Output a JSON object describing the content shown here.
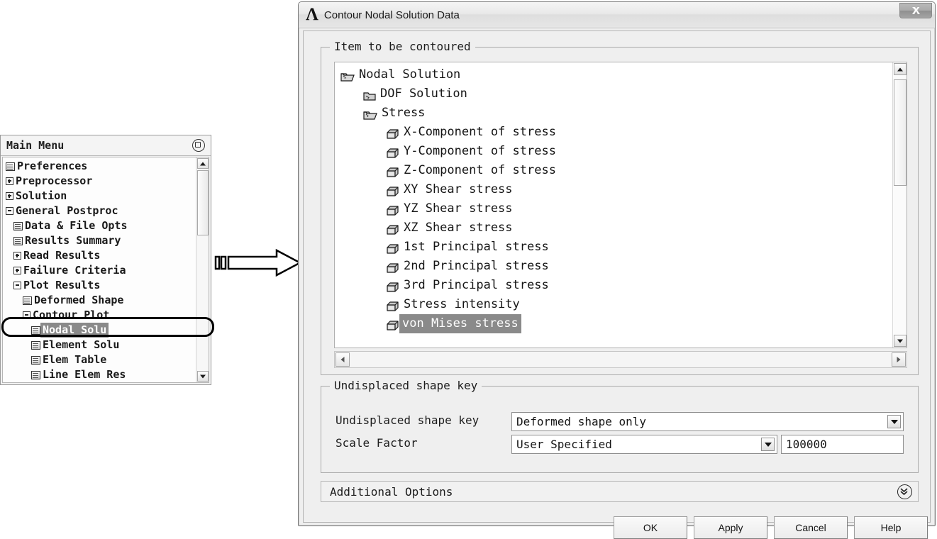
{
  "main_menu": {
    "title": "Main Menu",
    "pin_icon": "pin-circle-icon",
    "items": [
      {
        "label": "Preferences",
        "indent": 0,
        "icon": "document-icon",
        "selected": false
      },
      {
        "label": "Preprocessor",
        "indent": 0,
        "icon": "plus-box-icon",
        "selected": false
      },
      {
        "label": "Solution",
        "indent": 0,
        "icon": "plus-box-icon",
        "selected": false
      },
      {
        "label": "General Postproc",
        "indent": 0,
        "icon": "minus-box-icon",
        "selected": false
      },
      {
        "label": "Data & File Opts",
        "indent": 1,
        "icon": "document-icon",
        "selected": false
      },
      {
        "label": "Results Summary",
        "indent": 1,
        "icon": "document-icon",
        "selected": false
      },
      {
        "label": "Read Results",
        "indent": 1,
        "icon": "plus-box-icon",
        "selected": false
      },
      {
        "label": "Failure Criteria",
        "indent": 1,
        "icon": "plus-box-icon",
        "selected": false
      },
      {
        "label": "Plot Results",
        "indent": 1,
        "icon": "minus-box-icon",
        "selected": false
      },
      {
        "label": "Deformed Shape",
        "indent": 2,
        "icon": "document-icon",
        "selected": false
      },
      {
        "label": "Contour Plot",
        "indent": 2,
        "icon": "minus-box-icon",
        "selected": false
      },
      {
        "label": "Nodal Solu",
        "indent": 3,
        "icon": "document-icon",
        "selected": true
      },
      {
        "label": "Element Solu",
        "indent": 3,
        "icon": "document-icon",
        "selected": false
      },
      {
        "label": "Elem Table",
        "indent": 3,
        "icon": "document-icon",
        "selected": false
      },
      {
        "label": "Line Elem Res",
        "indent": 3,
        "icon": "document-icon",
        "selected": false
      }
    ]
  },
  "annotation": {
    "arrow_icon": "right-arrow-callout",
    "highlight_target": "Nodal Solu"
  },
  "dialog": {
    "title": "Contour Nodal Solution Data",
    "logo_glyph": "Λ",
    "close_label": "✕",
    "item_group": {
      "legend": "Item to be contoured",
      "tree": [
        {
          "label": "Nodal Solution",
          "indent": 0,
          "icon": "folder-open-icon",
          "selected": false
        },
        {
          "label": "DOF Solution",
          "indent": 1,
          "icon": "folder-closed-icon",
          "selected": false
        },
        {
          "label": "Stress",
          "indent": 1,
          "icon": "folder-open-icon",
          "selected": false
        },
        {
          "label": "X-Component of stress",
          "indent": 2,
          "icon": "cube-icon",
          "selected": false
        },
        {
          "label": "Y-Component of stress",
          "indent": 2,
          "icon": "cube-icon",
          "selected": false
        },
        {
          "label": "Z-Component of stress",
          "indent": 2,
          "icon": "cube-icon",
          "selected": false
        },
        {
          "label": "XY Shear stress",
          "indent": 2,
          "icon": "cube-icon",
          "selected": false
        },
        {
          "label": "YZ Shear stress",
          "indent": 2,
          "icon": "cube-icon",
          "selected": false
        },
        {
          "label": "XZ Shear stress",
          "indent": 2,
          "icon": "cube-icon",
          "selected": false
        },
        {
          "label": "1st Principal stress",
          "indent": 2,
          "icon": "cube-icon",
          "selected": false
        },
        {
          "label": "2nd Principal stress",
          "indent": 2,
          "icon": "cube-icon",
          "selected": false
        },
        {
          "label": "3rd Principal stress",
          "indent": 2,
          "icon": "cube-icon",
          "selected": false
        },
        {
          "label": "Stress intensity",
          "indent": 2,
          "icon": "cube-icon",
          "selected": false
        },
        {
          "label": "von Mises stress",
          "indent": 2,
          "icon": "cube-icon",
          "selected": true
        }
      ]
    },
    "undisplaced_group": {
      "legend": "Undisplaced shape key",
      "shape_key_label": "Undisplaced shape key",
      "shape_key_value": "Deformed shape only",
      "scale_factor_label": "Scale Factor",
      "scale_factor_value": "User Specified",
      "scale_factor_number": "100000"
    },
    "additional_options": {
      "label": "Additional Options",
      "expander_icon": "double-chevron-down-icon"
    },
    "buttons": {
      "ok": "OK",
      "apply": "Apply",
      "cancel": "Cancel",
      "help": "Help"
    }
  },
  "colors": {
    "selection_bg": "#8a8a8a",
    "selection_fg": "#ffffff",
    "dialog_bg": "#efefef",
    "list_bg": "#ffffff",
    "annotation_outline": "#000000"
  }
}
